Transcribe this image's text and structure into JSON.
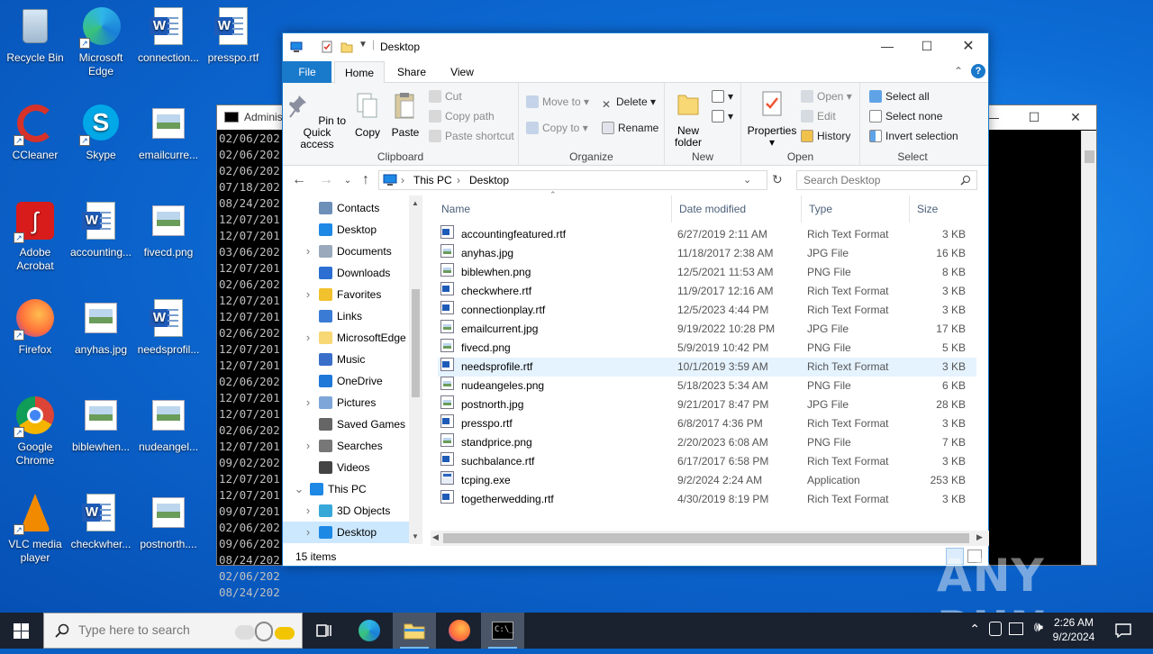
{
  "desktop_icons": [
    {
      "label": "Recycle Bin",
      "kind": "recycle"
    },
    {
      "label": "Microsoft Edge",
      "kind": "edge"
    },
    {
      "label": "connection...",
      "kind": "word"
    },
    {
      "label": "presspo.rtf",
      "kind": "word"
    },
    {
      "label": "CCleaner",
      "kind": "ccleaner"
    },
    {
      "label": "Skype",
      "kind": "skype"
    },
    {
      "label": "emailcurre...",
      "kind": "image"
    },
    {
      "label": "Adobe Acrobat",
      "kind": "acrobat"
    },
    {
      "label": "accounting...",
      "kind": "word"
    },
    {
      "label": "fivecd.png",
      "kind": "image"
    },
    {
      "label": "Firefox",
      "kind": "firefox"
    },
    {
      "label": "anyhas.jpg",
      "kind": "image"
    },
    {
      "label": "needsprofil...",
      "kind": "word"
    },
    {
      "label": "Google Chrome",
      "kind": "chrome"
    },
    {
      "label": "biblewhen...",
      "kind": "image"
    },
    {
      "label": "nudeangel...",
      "kind": "image"
    },
    {
      "label": "VLC media player",
      "kind": "vlc"
    },
    {
      "label": "checkwher...",
      "kind": "word"
    },
    {
      "label": "postnorth....",
      "kind": "image"
    }
  ],
  "cmd_window": {
    "title": "Adminis",
    "lines": [
      "02/06/202",
      "02/06/202",
      "02/06/202",
      "07/18/202",
      "08/24/202",
      "12/07/201",
      "12/07/201",
      "03/06/202",
      "12/07/201",
      "02/06/202",
      "12/07/201",
      "12/07/201",
      "02/06/202",
      "12/07/201",
      "12/07/201",
      "02/06/202",
      "12/07/201",
      "12/07/201",
      "02/06/202",
      "12/07/201",
      "09/02/202",
      "12/07/201",
      "12/07/201",
      "09/07/201",
      "02/06/202",
      "09/06/202",
      "08/24/202",
      "02/06/202",
      "08/24/202"
    ]
  },
  "explorer": {
    "title": "Desktop",
    "tabs": {
      "file": "File",
      "home": "Home",
      "share": "Share",
      "view": "View"
    },
    "ribbon": {
      "pin_quick_access": "Pin to Quick access",
      "copy": "Copy",
      "paste": "Paste",
      "cut": "Cut",
      "copy_path": "Copy path",
      "paste_shortcut": "Paste shortcut",
      "clipboard": "Clipboard",
      "move_to": "Move to",
      "copy_to": "Copy to",
      "delete": "Delete",
      "rename": "Rename",
      "organize": "Organize",
      "new_folder": "New folder",
      "new": "New",
      "properties": "Properties",
      "open": "Open",
      "edit": "Edit",
      "history": "History",
      "open_group": "Open",
      "select_all": "Select all",
      "select_none": "Select none",
      "invert_selection": "Invert selection",
      "select_group": "Select"
    },
    "address": {
      "this_pc": "This PC",
      "desktop": "Desktop"
    },
    "search_placeholder": "Search Desktop",
    "nav_items": [
      {
        "label": "Contacts",
        "indent": 1,
        "chev": ""
      },
      {
        "label": "Desktop",
        "indent": 1,
        "chev": ""
      },
      {
        "label": "Documents",
        "indent": 1,
        "chev": ">"
      },
      {
        "label": "Downloads",
        "indent": 1,
        "chev": ""
      },
      {
        "label": "Favorites",
        "indent": 1,
        "chev": ">"
      },
      {
        "label": "Links",
        "indent": 1,
        "chev": ""
      },
      {
        "label": "MicrosoftEdge",
        "indent": 1,
        "chev": ">"
      },
      {
        "label": "Music",
        "indent": 1,
        "chev": ""
      },
      {
        "label": "OneDrive",
        "indent": 1,
        "chev": ""
      },
      {
        "label": "Pictures",
        "indent": 1,
        "chev": ">"
      },
      {
        "label": "Saved Games",
        "indent": 1,
        "chev": ""
      },
      {
        "label": "Searches",
        "indent": 1,
        "chev": ">"
      },
      {
        "label": "Videos",
        "indent": 1,
        "chev": ""
      },
      {
        "label": "This PC",
        "indent": 0,
        "chev": "v"
      },
      {
        "label": "3D Objects",
        "indent": 1,
        "chev": ">"
      },
      {
        "label": "Desktop",
        "indent": 1,
        "chev": ">",
        "selected": true
      }
    ],
    "columns": {
      "name": "Name",
      "date": "Date modified",
      "type": "Type",
      "size": "Size"
    },
    "files": [
      {
        "name": "accountingfeatured.rtf",
        "date": "6/27/2019 2:11 AM",
        "type": "Rich Text Format",
        "size": "3 KB",
        "icon": "rtf"
      },
      {
        "name": "anyhas.jpg",
        "date": "11/18/2017 2:38 AM",
        "type": "JPG File",
        "size": "16 KB",
        "icon": "img"
      },
      {
        "name": "biblewhen.png",
        "date": "12/5/2021 11:53 AM",
        "type": "PNG File",
        "size": "8 KB",
        "icon": "img"
      },
      {
        "name": "checkwhere.rtf",
        "date": "11/9/2017 12:16 AM",
        "type": "Rich Text Format",
        "size": "3 KB",
        "icon": "rtf"
      },
      {
        "name": "connectionplay.rtf",
        "date": "12/5/2023 4:44 PM",
        "type": "Rich Text Format",
        "size": "3 KB",
        "icon": "rtf"
      },
      {
        "name": "emailcurrent.jpg",
        "date": "9/19/2022 10:28 PM",
        "type": "JPG File",
        "size": "17 KB",
        "icon": "img"
      },
      {
        "name": "fivecd.png",
        "date": "5/9/2019 10:42 PM",
        "type": "PNG File",
        "size": "5 KB",
        "icon": "img"
      },
      {
        "name": "needsprofile.rtf",
        "date": "10/1/2019 3:59 AM",
        "type": "Rich Text Format",
        "size": "3 KB",
        "icon": "rtf",
        "selected": true
      },
      {
        "name": "nudeangeles.png",
        "date": "5/18/2023 5:34 AM",
        "type": "PNG File",
        "size": "6 KB",
        "icon": "img"
      },
      {
        "name": "postnorth.jpg",
        "date": "9/21/2017 8:47 PM",
        "type": "JPG File",
        "size": "28 KB",
        "icon": "img"
      },
      {
        "name": "presspo.rtf",
        "date": "6/8/2017 4:36 PM",
        "type": "Rich Text Format",
        "size": "3 KB",
        "icon": "rtf"
      },
      {
        "name": "standprice.png",
        "date": "2/20/2023 6:08 AM",
        "type": "PNG File",
        "size": "7 KB",
        "icon": "img"
      },
      {
        "name": "suchbalance.rtf",
        "date": "6/17/2017 6:58 PM",
        "type": "Rich Text Format",
        "size": "3 KB",
        "icon": "rtf"
      },
      {
        "name": "tcping.exe",
        "date": "9/2/2024 2:24 AM",
        "type": "Application",
        "size": "253 KB",
        "icon": "exe"
      },
      {
        "name": "togetherwedding.rtf",
        "date": "4/30/2019 8:19 PM",
        "type": "Rich Text Format",
        "size": "3 KB",
        "icon": "rtf"
      }
    ],
    "status": "15 items"
  },
  "taskbar": {
    "search_placeholder": "Type here to search",
    "time": "2:26 AM",
    "date": "9/2/2024"
  },
  "watermark": "ANY RUN",
  "colors": {
    "accent": "#1979ca",
    "file_tab": "#1979ca",
    "selection": "#e5f3ff"
  }
}
